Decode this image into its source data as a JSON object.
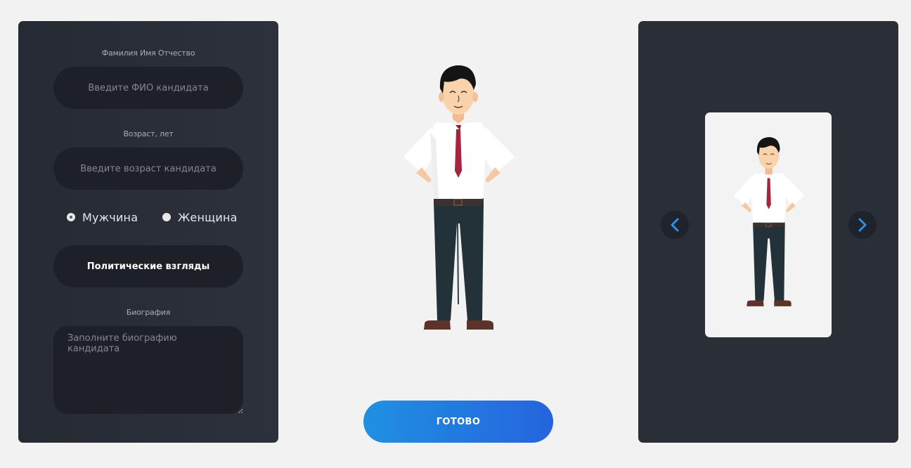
{
  "form": {
    "fio_label": "Фамилия Имя Отчество",
    "fio_placeholder": "Введите ФИО кандидата",
    "fio_value": "",
    "age_label": "Возраст, лет",
    "age_placeholder": "Введите возраст кандидата",
    "age_value": "",
    "gender_options": [
      {
        "label": "Мужчина",
        "selected": true
      },
      {
        "label": "Женщина",
        "selected": false
      }
    ],
    "politics_label": "Политические взгляды",
    "bio_label": "Биография",
    "bio_placeholder": "Заполните биографию кандидата",
    "bio_value": ""
  },
  "actions": {
    "done_label": "ГОТОВО"
  },
  "gallery": {
    "prev_icon": "chevron-left-icon",
    "next_icon": "chevron-right-icon"
  },
  "colors": {
    "panel": "#2a2e37",
    "input": "#1d2027",
    "accent": "#2090e2",
    "chevron": "#2f8ef0",
    "tie": "#a3263c",
    "pants": "#233238"
  }
}
